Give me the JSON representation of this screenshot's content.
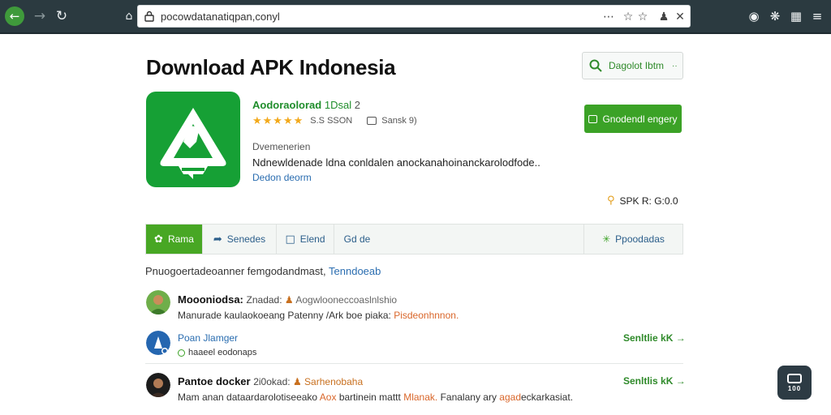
{
  "browser": {
    "url": "pocowdatanatiqpan,conyl",
    "icons": {
      "back": "arrow-left-icon",
      "forward": "arrow-right-icon",
      "reload": "reload-icon",
      "home": "home-icon",
      "lock": "lock-icon",
      "more": "more-dots-icon",
      "star": "star-icon",
      "reader": "reader-icon",
      "account": "account-icon",
      "close": "close-icon",
      "extension": "extension-icon",
      "puzzle": "puzzle-icon",
      "library": "library-icon",
      "menu": "hamburger-menu-icon"
    }
  },
  "header": {
    "title": "Download APK Indonesia",
    "search_label": "Dagolot Ibtm",
    "search_caret": "··"
  },
  "app": {
    "name": "Aodoraolorad",
    "version": "1Dsal",
    "version_suffix": "2",
    "stars": "★★★★★",
    "rating_count": "S.S SSON",
    "size": "Sansk 9)",
    "download_label": "Gnodendl engery",
    "description_label": "Dvemenerien",
    "description": "Ndnewldenade ldna conldalen anockanahoinanckarolodfode..",
    "description_link": "Dedon deorm",
    "apk_version": "SPK R: G:0.0"
  },
  "tabs": [
    {
      "label": "Rama",
      "icon": "leaf-icon",
      "active": true
    },
    {
      "label": "Senedes",
      "icon": "share-icon",
      "active": false
    },
    {
      "label": "Elend",
      "icon": "comment-icon",
      "active": false
    },
    {
      "label": "Gd de",
      "icon": "",
      "active": false
    }
  ],
  "tab_right": {
    "label": "Ppoodadas",
    "icon": "recycle-icon"
  },
  "comments_section": {
    "heading_prefix": "Pnuogoertadeoanner",
    "heading_mid": "femgodandmast,",
    "heading_link": "Tenndoeab"
  },
  "comments": [
    {
      "name": "Moooniodsa:",
      "meta_a": "Znadad:",
      "meta_b": "Aogwlooneccoaslnlshio",
      "text_a": "Manurade kaulaokoeang Patenny /Ark boe piaka:",
      "text_b": "Pisdeonhnnon."
    },
    {
      "name": "Poan Jlamger",
      "sub": "haaeel eodonaps",
      "show_label": "Senltlie kK"
    },
    {
      "name": "Pantoe docker",
      "meta_a": "2i0okad:",
      "meta_b": "Sarhenobaha",
      "text_a": "Mam anan dataardarolotiseeako",
      "text_b": "Aox",
      "text_c": "bartinein mattt",
      "text_d": "Mlanak.",
      "text_e": "Fanalany ary",
      "text_f": "agad",
      "text_g": "eckarkasiat.",
      "show_label": "Senltlis kK"
    }
  ],
  "chat": {
    "label": "100",
    "icon": "chat-icon"
  },
  "colors": {
    "brand_green": "#3ba226",
    "app_icon_green": "#16a035",
    "link_blue": "#2a6db0",
    "chrome_dark": "#2b3a40",
    "star_gold": "#f2a91b"
  }
}
